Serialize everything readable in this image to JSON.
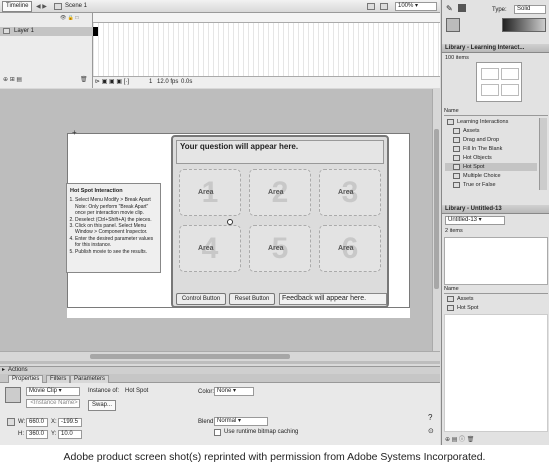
{
  "toolbar": {
    "timeline_btn": "Timeline",
    "scene": "Scene 1",
    "zoom": "100%"
  },
  "timeline": {
    "layer_name": "Layer 1",
    "frame_num": "1",
    "fps": "12.0 fps",
    "time": "0.0s"
  },
  "stage": {
    "instructions_title": "Hot Spot Interaction",
    "instructions": [
      "Select Menu Modify > Break Apart Note: Only perform \"Break Apart\" once per interaction movie clip.",
      "Deselect (Ctrl+Shift+A) the pieces.",
      "Click on this panel. Select Menu Window > Component Inspector.",
      "Enter the desired parameter values for this instance.",
      "Publish movie to see the results."
    ],
    "question": "Your question will appear here.",
    "areas": [
      {
        "num": "1",
        "label": "Area"
      },
      {
        "num": "2",
        "label": "Area"
      },
      {
        "num": "3",
        "label": "Area"
      },
      {
        "num": "4",
        "label": "Area"
      },
      {
        "num": "5",
        "label": "Area"
      },
      {
        "num": "6",
        "label": "Area"
      }
    ],
    "control_btn": "Control Button",
    "reset_btn": "Reset Button",
    "feedback": "Feedback will appear here."
  },
  "props": {
    "actions": "Actions",
    "tabs": [
      "Properties",
      "Filters",
      "Parameters"
    ],
    "symbol_type": "Movie Clip",
    "instance_name_placeholder": "<Instance Name>",
    "instance_of_label": "Instance of:",
    "instance_of": "Hot Spot",
    "swap_btn": "Swap...",
    "color_label": "Color:",
    "color_value": "None",
    "blend_label": "Blend:",
    "blend_value": "Normal",
    "bitmap_caching": "Use runtime bitmap caching",
    "w_label": "W:",
    "w": "660.0",
    "x_label": "X:",
    "x": "-199.5",
    "h_label": "H:",
    "h": "360.0",
    "y_label": "Y:",
    "y": "10.0"
  },
  "right": {
    "type_label": "Type:",
    "type_value": "Solid",
    "library1_title": "Library - Learning Interact...",
    "library1_count": "100 items",
    "name_header": "Name",
    "library1_items": [
      "Learning Interactions",
      "Assets",
      "Drag and Drop",
      "Fill In The Blank",
      "Hot Objects",
      "Hot Spot",
      "Multiple Choice",
      "True or False"
    ],
    "library2_title": "Library - Untitled-13",
    "library2_doc": "Untitled-13",
    "library2_count": "2 items",
    "library2_items": [
      "Assets",
      "Hot Spot"
    ]
  },
  "caption": "Adobe product screen shot(s) reprinted with permission from Adobe Systems Incorporated."
}
